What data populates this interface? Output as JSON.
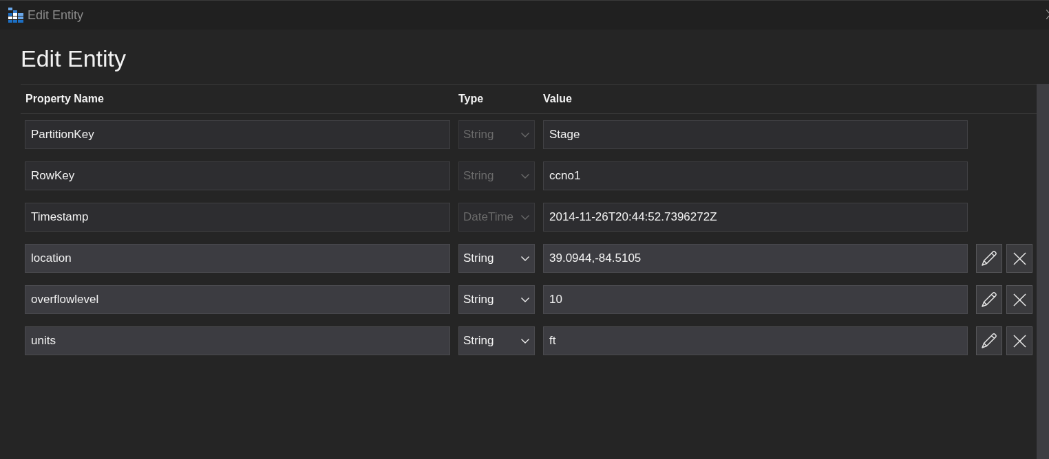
{
  "window": {
    "title": "Edit Entity"
  },
  "heading": "Edit Entity",
  "table": {
    "columns": [
      "Property Name",
      "Type",
      "Value"
    ],
    "rows": [
      {
        "name": "PartitionKey",
        "type": "String",
        "value": "Stage",
        "editable": false
      },
      {
        "name": "RowKey",
        "type": "String",
        "value": "ccno1",
        "editable": false
      },
      {
        "name": "Timestamp",
        "type": "DateTime",
        "value": "2014-11-26T20:44:52.7396272Z",
        "editable": false
      },
      {
        "name": "location",
        "type": "String",
        "value": "39.0944,-84.5105",
        "editable": true
      },
      {
        "name": "overflowlevel",
        "type": "String",
        "value": "10",
        "editable": true
      },
      {
        "name": "units",
        "type": "String",
        "value": "ft",
        "editable": true
      }
    ]
  }
}
